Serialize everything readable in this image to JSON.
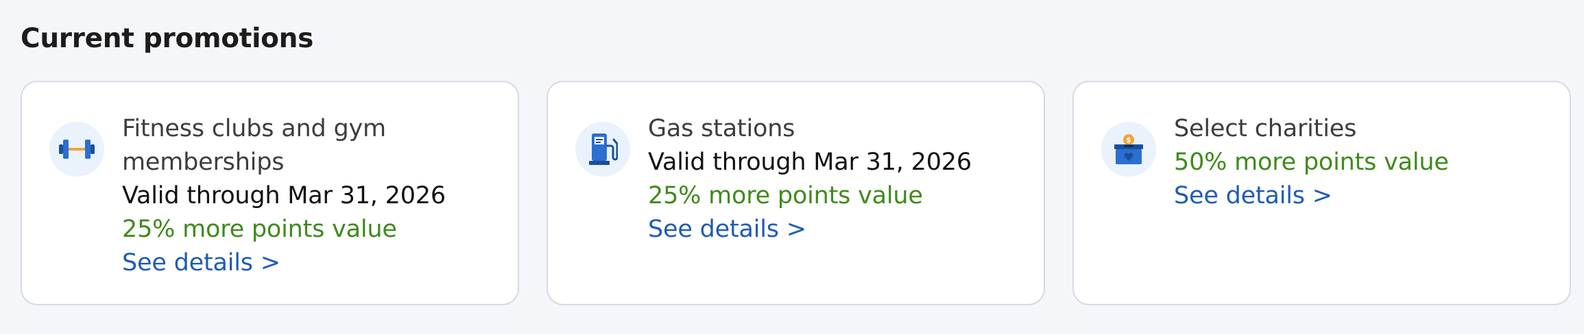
{
  "section": {
    "title": "Current promotions"
  },
  "colors": {
    "page_background": "#f5f6f9",
    "card_border": "#d7dae3",
    "bonus_text": "#3f8a1c",
    "link_text": "#1f5bb5",
    "icon_circle": "#eaf2fb"
  },
  "promotions": [
    {
      "icon": "dumbbell-icon",
      "title": "Fitness clubs and gym memberships",
      "valid": "Valid through Mar 31, 2026",
      "bonus": "25% more points value",
      "link": "See details >"
    },
    {
      "icon": "gas-pump-icon",
      "title": "Gas stations",
      "valid": "Valid through Mar 31, 2026",
      "bonus": "25% more points value",
      "link": "See details >"
    },
    {
      "icon": "donation-box-icon",
      "title": "Select charities",
      "bonus": "50% more points value",
      "link": "See details >"
    }
  ]
}
